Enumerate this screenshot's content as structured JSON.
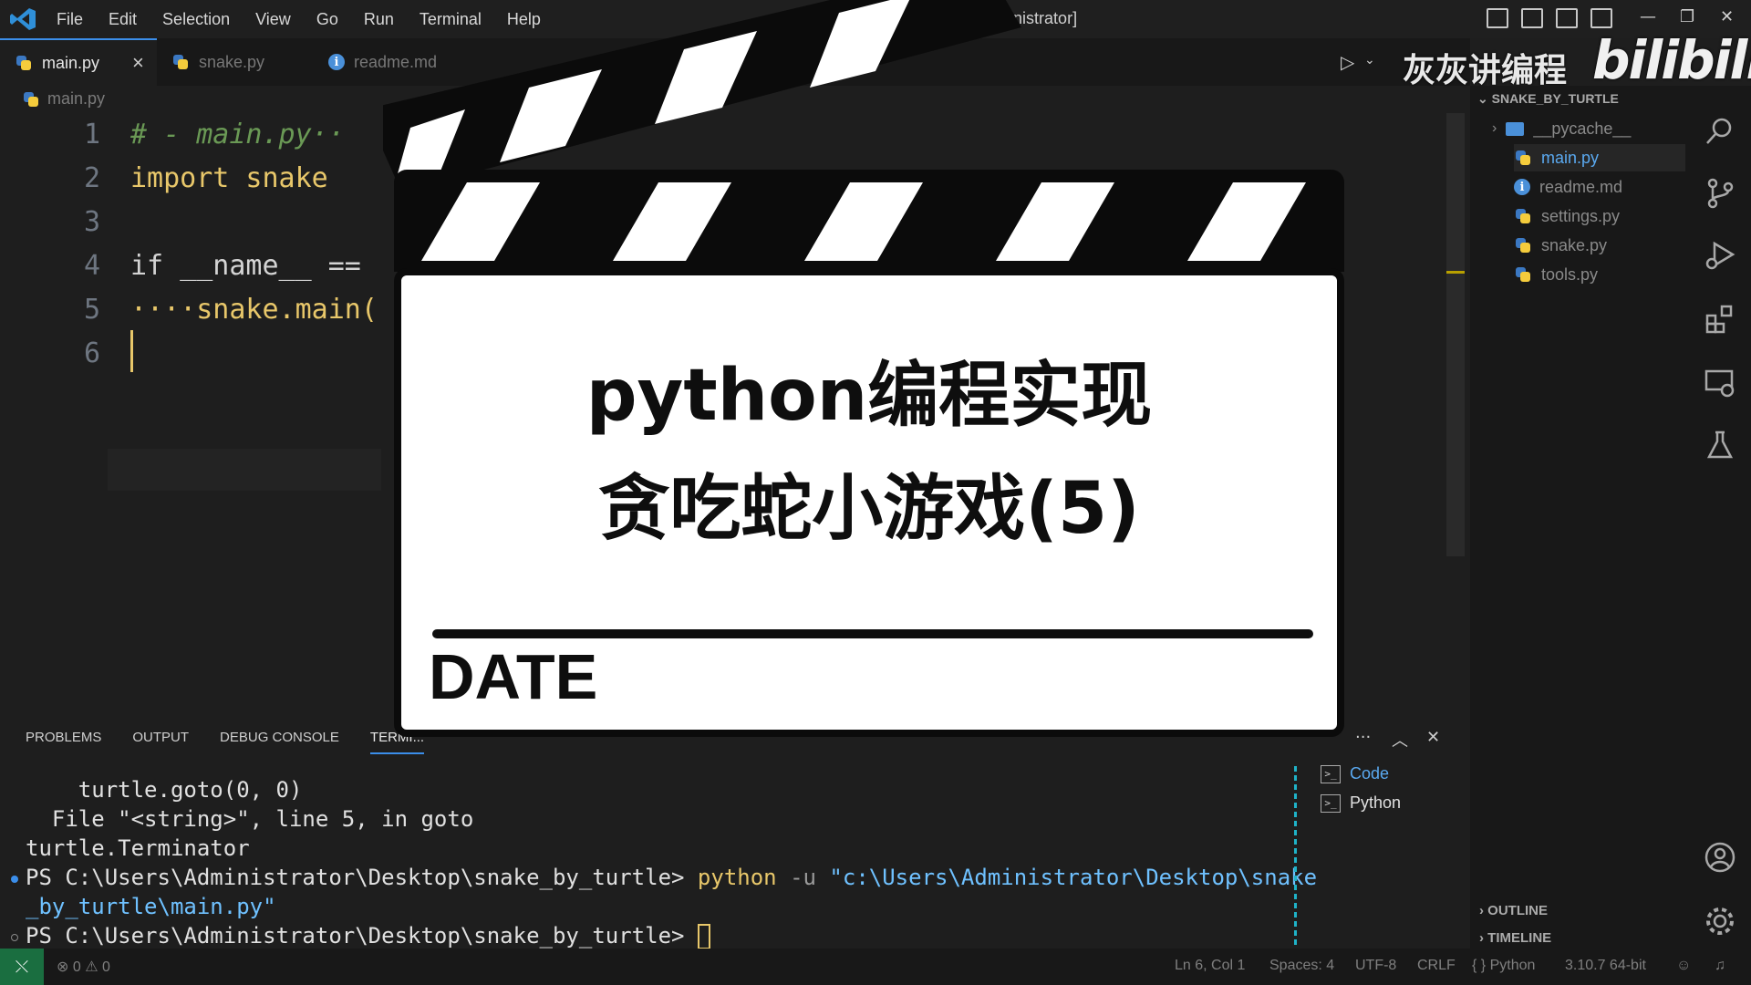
{
  "titlebar": {
    "menus": [
      "File",
      "Edit",
      "Selection",
      "View",
      "Go",
      "Run",
      "Terminal",
      "Help"
    ],
    "window_title": "ode [Administrator]"
  },
  "tabs": [
    {
      "label": "main.py",
      "active": true,
      "icon": "python-file-icon"
    },
    {
      "label": "snake.py",
      "active": false,
      "icon": "python-file-icon"
    },
    {
      "label": "readme.md",
      "active": false,
      "icon": "info-icon"
    }
  ],
  "breadcrumb": {
    "file": "main.py"
  },
  "editor": {
    "lines": [
      {
        "num": "1",
        "text": "# - main.py··"
      },
      {
        "num": "2",
        "text": "import snake"
      },
      {
        "num": "3",
        "text": ""
      },
      {
        "num": "4",
        "text": "if __name__ =="
      },
      {
        "num": "5",
        "text": "····snake.main("
      },
      {
        "num": "6",
        "text": ""
      }
    ]
  },
  "watermark": {
    "text": "灰灰讲编程",
    "logo": "bilibili"
  },
  "explorer": {
    "header": "SNAKE_BY_TURTLE",
    "items": [
      {
        "label": "__pycache__",
        "type": "folder"
      },
      {
        "label": "main.py",
        "type": "python",
        "selected": true
      },
      {
        "label": "readme.md",
        "type": "info"
      },
      {
        "label": "settings.py",
        "type": "python"
      },
      {
        "label": "snake.py",
        "type": "python"
      },
      {
        "label": "tools.py",
        "type": "python"
      }
    ],
    "sections": [
      "OUTLINE",
      "TIMELINE"
    ]
  },
  "panel": {
    "tabs": [
      "PROBLEMS",
      "OUTPUT",
      "DEBUG CONSOLE",
      "TERMI..."
    ],
    "terminal": {
      "line1": "    turtle.goto(0, 0)",
      "line2": "  File \"<string>\", line 5, in goto",
      "line3": "turtle.Terminator",
      "prompt1": "PS C:\\Users\\Administrator\\Desktop\\snake_by_turtle> ",
      "cmd_python": "python",
      "cmd_flag": " -u ",
      "cmd_path": "\"c:\\Users\\Administrator\\Desktop\\snake",
      "cmd_path2": "_by_turtle\\main.py\"",
      "prompt2": "PS C:\\Users\\Administrator\\Desktop\\snake_by_turtle> "
    },
    "terminals": [
      {
        "label": "Code",
        "active": true
      },
      {
        "label": "Python",
        "active": false
      }
    ]
  },
  "status": {
    "errors": "0",
    "warnings": "0",
    "position": "Ln 6, Col 1",
    "spaces": "Spaces: 4",
    "encoding": "UTF-8",
    "eol": "CRLF",
    "language": "Python",
    "interpreter": "3.10.7 64-bit"
  },
  "slate": {
    "title_line1": "python编程实现",
    "title_line2": "贪吃蛇小游戏(5)",
    "date_label": "DATE"
  },
  "colors": {
    "accent": "#3b8eea",
    "keyword": "#569cd6",
    "identifier": "#e8c76a",
    "comment": "#6a9955",
    "remote": "#1a6e40"
  }
}
